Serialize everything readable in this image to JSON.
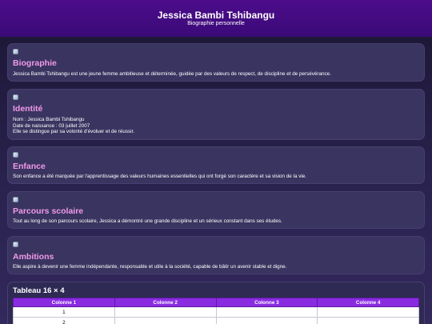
{
  "header": {
    "title": "Jessica Bambi Tshibangu",
    "subtitle": "Biographie personnelle"
  },
  "sections": [
    {
      "title": "Biographie",
      "lines": [
        "Jessica Bambi Tshibangu est une jeune femme ambitieuse et déterminée, guidée par des valeurs de respect, de discipline et de persévérance."
      ]
    },
    {
      "title": "Identité",
      "lines": [
        "Nom : Jessica Bambi Tshibangu",
        "Date de naissance : 03 juillet 2007",
        "Elle se distingue par sa volonté d'évoluer et de réussir."
      ]
    },
    {
      "title": "Enfance",
      "lines": [
        "Son enfance a été marquée par l'apprentissage des valeurs humaines essentielles qui ont forgé son caractère et sa vision de la vie."
      ]
    },
    {
      "title": "Parcours scolaire",
      "lines": [
        "Tout au long de son parcours scolaire, Jessica a démontré une grande discipline et un sérieux constant dans ses études."
      ]
    },
    {
      "title": "Ambitions",
      "lines": [
        "Elle aspire à devenir une femme indépendante, responsable et utile à la société, capable de bâtir un avenir stable et digne."
      ]
    }
  ],
  "table": {
    "title": "Tableau 16 × 4",
    "headers": [
      "Colonne 1",
      "Colonne 2",
      "Colonne 3",
      "Colonne 4"
    ],
    "rows": [
      [
        "1",
        "",
        "",
        ""
      ],
      [
        "2",
        "",
        "",
        ""
      ]
    ]
  },
  "colors": {
    "accent_title": "#f09ae8",
    "header_bg": "#4c0c8a",
    "table_header_bg": "#8a2be2"
  },
  "icons": [
    "broken-image-icon"
  ]
}
